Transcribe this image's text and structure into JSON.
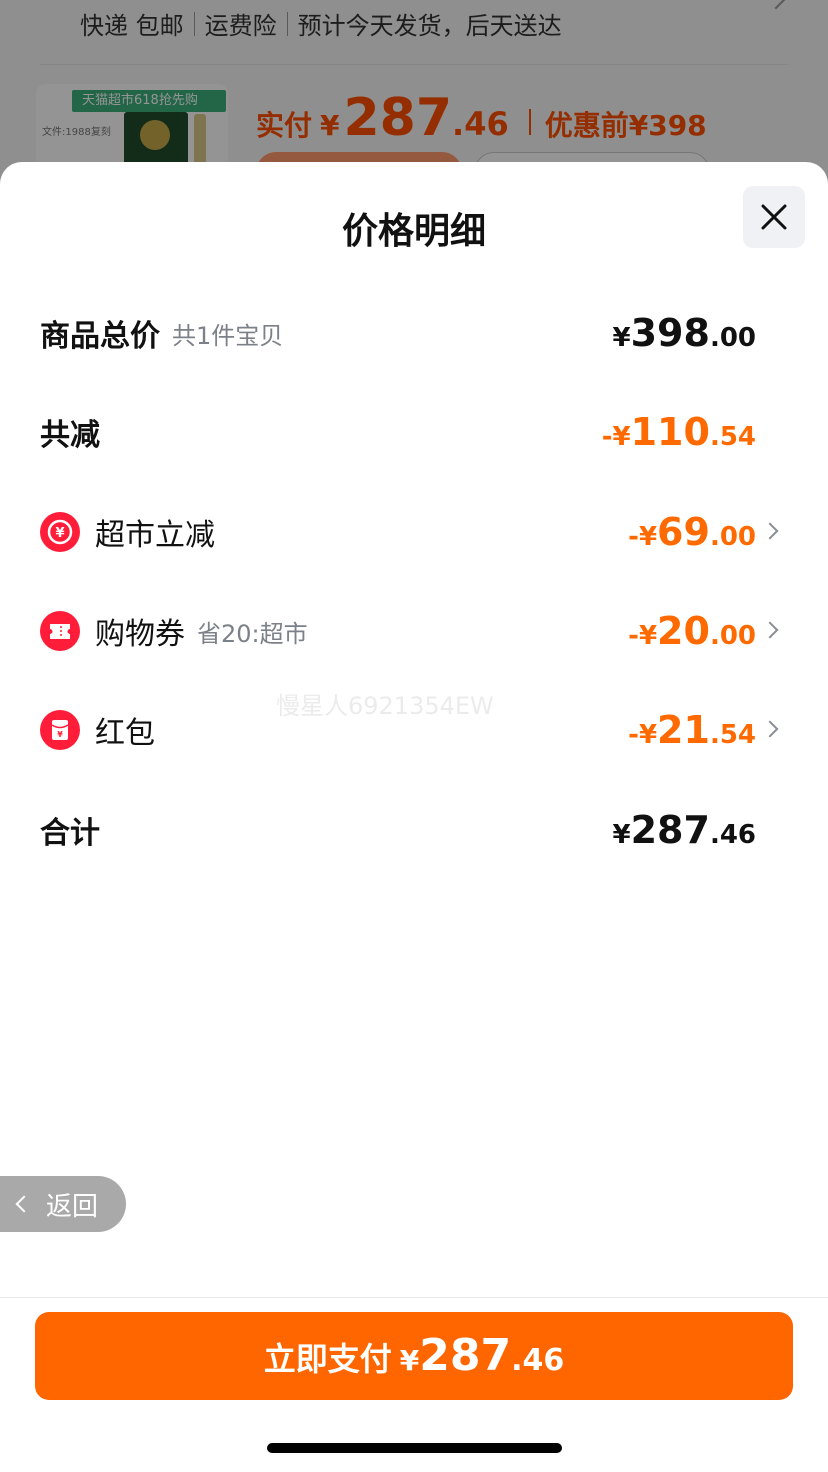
{
  "background_page": {
    "shipping_items": [
      "快递 包邮",
      "运费险",
      "预计今天发货，后天送达"
    ],
    "product_banner": "天猫超市618抢先购",
    "product_tiny_text": "文件:1988复刻",
    "price_label": "实付",
    "currency": "¥",
    "price_int": "287",
    "price_dec": ".46",
    "pre_discount": "优惠前¥398"
  },
  "sheet": {
    "title": "价格明细",
    "close_icon": "close-icon"
  },
  "rows": {
    "total": {
      "label": "商品总价",
      "sub": "共1件宝贝",
      "cur": "¥",
      "int": "398",
      "dec": ".00"
    },
    "discount": {
      "label": "共减",
      "cur": "-¥",
      "int": "110",
      "dec": ".54"
    },
    "supermarket": {
      "label": "超市立减",
      "icon": "yuan-discount-icon",
      "cur": "-¥",
      "int": "69",
      "dec": ".00"
    },
    "coupon": {
      "label": "购物券",
      "sub": "省20:超市",
      "icon": "ticket-icon",
      "cur": "-¥",
      "int": "20",
      "dec": ".00"
    },
    "redpacket": {
      "label": "红包",
      "icon": "red-packet-icon",
      "cur": "-¥",
      "int": "21",
      "dec": ".54"
    },
    "sum": {
      "label": "合计",
      "cur": "¥",
      "int": "287",
      "dec": ".46"
    }
  },
  "watermark": "慢星人6921354EW",
  "back_button": {
    "label": "返回"
  },
  "pay_button": {
    "label": "立即支付",
    "cur": "¥",
    "int": "287",
    "dec": ".46"
  },
  "colors": {
    "accent": "#ff6600",
    "discount": "#ff6a00",
    "icon_red": "#ff1d3a"
  }
}
